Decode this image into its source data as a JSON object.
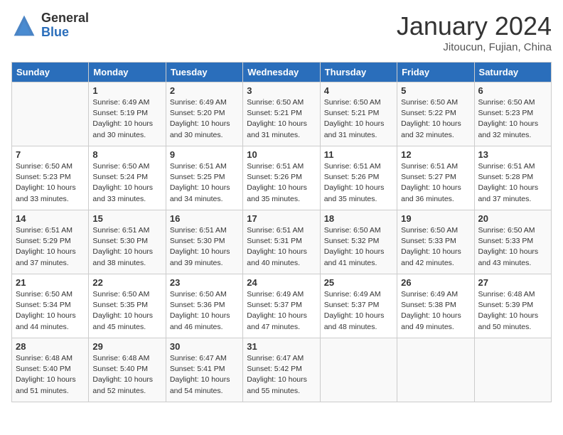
{
  "header": {
    "logo_general": "General",
    "logo_blue": "Blue",
    "month_title": "January 2024",
    "subtitle": "Jitoucun, Fujian, China"
  },
  "days_of_week": [
    "Sunday",
    "Monday",
    "Tuesday",
    "Wednesday",
    "Thursday",
    "Friday",
    "Saturday"
  ],
  "weeks": [
    [
      {
        "day": "",
        "sunrise": "",
        "sunset": "",
        "daylight": ""
      },
      {
        "day": "1",
        "sunrise": "Sunrise: 6:49 AM",
        "sunset": "Sunset: 5:19 PM",
        "daylight": "Daylight: 10 hours and 30 minutes."
      },
      {
        "day": "2",
        "sunrise": "Sunrise: 6:49 AM",
        "sunset": "Sunset: 5:20 PM",
        "daylight": "Daylight: 10 hours and 30 minutes."
      },
      {
        "day": "3",
        "sunrise": "Sunrise: 6:50 AM",
        "sunset": "Sunset: 5:21 PM",
        "daylight": "Daylight: 10 hours and 31 minutes."
      },
      {
        "day": "4",
        "sunrise": "Sunrise: 6:50 AM",
        "sunset": "Sunset: 5:21 PM",
        "daylight": "Daylight: 10 hours and 31 minutes."
      },
      {
        "day": "5",
        "sunrise": "Sunrise: 6:50 AM",
        "sunset": "Sunset: 5:22 PM",
        "daylight": "Daylight: 10 hours and 32 minutes."
      },
      {
        "day": "6",
        "sunrise": "Sunrise: 6:50 AM",
        "sunset": "Sunset: 5:23 PM",
        "daylight": "Daylight: 10 hours and 32 minutes."
      }
    ],
    [
      {
        "day": "7",
        "sunrise": "Sunrise: 6:50 AM",
        "sunset": "Sunset: 5:23 PM",
        "daylight": "Daylight: 10 hours and 33 minutes."
      },
      {
        "day": "8",
        "sunrise": "Sunrise: 6:50 AM",
        "sunset": "Sunset: 5:24 PM",
        "daylight": "Daylight: 10 hours and 33 minutes."
      },
      {
        "day": "9",
        "sunrise": "Sunrise: 6:51 AM",
        "sunset": "Sunset: 5:25 PM",
        "daylight": "Daylight: 10 hours and 34 minutes."
      },
      {
        "day": "10",
        "sunrise": "Sunrise: 6:51 AM",
        "sunset": "Sunset: 5:26 PM",
        "daylight": "Daylight: 10 hours and 35 minutes."
      },
      {
        "day": "11",
        "sunrise": "Sunrise: 6:51 AM",
        "sunset": "Sunset: 5:26 PM",
        "daylight": "Daylight: 10 hours and 35 minutes."
      },
      {
        "day": "12",
        "sunrise": "Sunrise: 6:51 AM",
        "sunset": "Sunset: 5:27 PM",
        "daylight": "Daylight: 10 hours and 36 minutes."
      },
      {
        "day": "13",
        "sunrise": "Sunrise: 6:51 AM",
        "sunset": "Sunset: 5:28 PM",
        "daylight": "Daylight: 10 hours and 37 minutes."
      }
    ],
    [
      {
        "day": "14",
        "sunrise": "Sunrise: 6:51 AM",
        "sunset": "Sunset: 5:29 PM",
        "daylight": "Daylight: 10 hours and 37 minutes."
      },
      {
        "day": "15",
        "sunrise": "Sunrise: 6:51 AM",
        "sunset": "Sunset: 5:30 PM",
        "daylight": "Daylight: 10 hours and 38 minutes."
      },
      {
        "day": "16",
        "sunrise": "Sunrise: 6:51 AM",
        "sunset": "Sunset: 5:30 PM",
        "daylight": "Daylight: 10 hours and 39 minutes."
      },
      {
        "day": "17",
        "sunrise": "Sunrise: 6:51 AM",
        "sunset": "Sunset: 5:31 PM",
        "daylight": "Daylight: 10 hours and 40 minutes."
      },
      {
        "day": "18",
        "sunrise": "Sunrise: 6:50 AM",
        "sunset": "Sunset: 5:32 PM",
        "daylight": "Daylight: 10 hours and 41 minutes."
      },
      {
        "day": "19",
        "sunrise": "Sunrise: 6:50 AM",
        "sunset": "Sunset: 5:33 PM",
        "daylight": "Daylight: 10 hours and 42 minutes."
      },
      {
        "day": "20",
        "sunrise": "Sunrise: 6:50 AM",
        "sunset": "Sunset: 5:33 PM",
        "daylight": "Daylight: 10 hours and 43 minutes."
      }
    ],
    [
      {
        "day": "21",
        "sunrise": "Sunrise: 6:50 AM",
        "sunset": "Sunset: 5:34 PM",
        "daylight": "Daylight: 10 hours and 44 minutes."
      },
      {
        "day": "22",
        "sunrise": "Sunrise: 6:50 AM",
        "sunset": "Sunset: 5:35 PM",
        "daylight": "Daylight: 10 hours and 45 minutes."
      },
      {
        "day": "23",
        "sunrise": "Sunrise: 6:50 AM",
        "sunset": "Sunset: 5:36 PM",
        "daylight": "Daylight: 10 hours and 46 minutes."
      },
      {
        "day": "24",
        "sunrise": "Sunrise: 6:49 AM",
        "sunset": "Sunset: 5:37 PM",
        "daylight": "Daylight: 10 hours and 47 minutes."
      },
      {
        "day": "25",
        "sunrise": "Sunrise: 6:49 AM",
        "sunset": "Sunset: 5:37 PM",
        "daylight": "Daylight: 10 hours and 48 minutes."
      },
      {
        "day": "26",
        "sunrise": "Sunrise: 6:49 AM",
        "sunset": "Sunset: 5:38 PM",
        "daylight": "Daylight: 10 hours and 49 minutes."
      },
      {
        "day": "27",
        "sunrise": "Sunrise: 6:48 AM",
        "sunset": "Sunset: 5:39 PM",
        "daylight": "Daylight: 10 hours and 50 minutes."
      }
    ],
    [
      {
        "day": "28",
        "sunrise": "Sunrise: 6:48 AM",
        "sunset": "Sunset: 5:40 PM",
        "daylight": "Daylight: 10 hours and 51 minutes."
      },
      {
        "day": "29",
        "sunrise": "Sunrise: 6:48 AM",
        "sunset": "Sunset: 5:40 PM",
        "daylight": "Daylight: 10 hours and 52 minutes."
      },
      {
        "day": "30",
        "sunrise": "Sunrise: 6:47 AM",
        "sunset": "Sunset: 5:41 PM",
        "daylight": "Daylight: 10 hours and 54 minutes."
      },
      {
        "day": "31",
        "sunrise": "Sunrise: 6:47 AM",
        "sunset": "Sunset: 5:42 PM",
        "daylight": "Daylight: 10 hours and 55 minutes."
      },
      {
        "day": "",
        "sunrise": "",
        "sunset": "",
        "daylight": ""
      },
      {
        "day": "",
        "sunrise": "",
        "sunset": "",
        "daylight": ""
      },
      {
        "day": "",
        "sunrise": "",
        "sunset": "",
        "daylight": ""
      }
    ]
  ]
}
